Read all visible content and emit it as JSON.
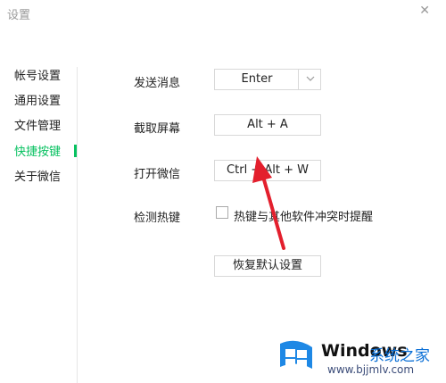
{
  "window": {
    "title": "设置",
    "close_glyph": "✕"
  },
  "sidebar": {
    "items": [
      {
        "label": "帐号设置"
      },
      {
        "label": "通用设置"
      },
      {
        "label": "文件管理"
      },
      {
        "label": "快捷按键",
        "active": true
      },
      {
        "label": "关于微信"
      }
    ]
  },
  "shortcuts": {
    "send": {
      "label": "发送消息",
      "value": "Enter"
    },
    "screenshot": {
      "label": "截取屏幕",
      "value": "Alt + A"
    },
    "open": {
      "label": "打开微信",
      "value": "Ctrl + Alt + W"
    },
    "detect": {
      "label": "检测热键",
      "checkbox_text": "热键与其他软件冲突时提醒",
      "checked": false
    },
    "restore_label": "恢复默认设置"
  },
  "watermark": {
    "brand": "Windows",
    "site": "系统之家",
    "url": "www.bjjmlv.com"
  },
  "colors": {
    "accent": "#07c160",
    "arrow": "#e31f2d"
  }
}
